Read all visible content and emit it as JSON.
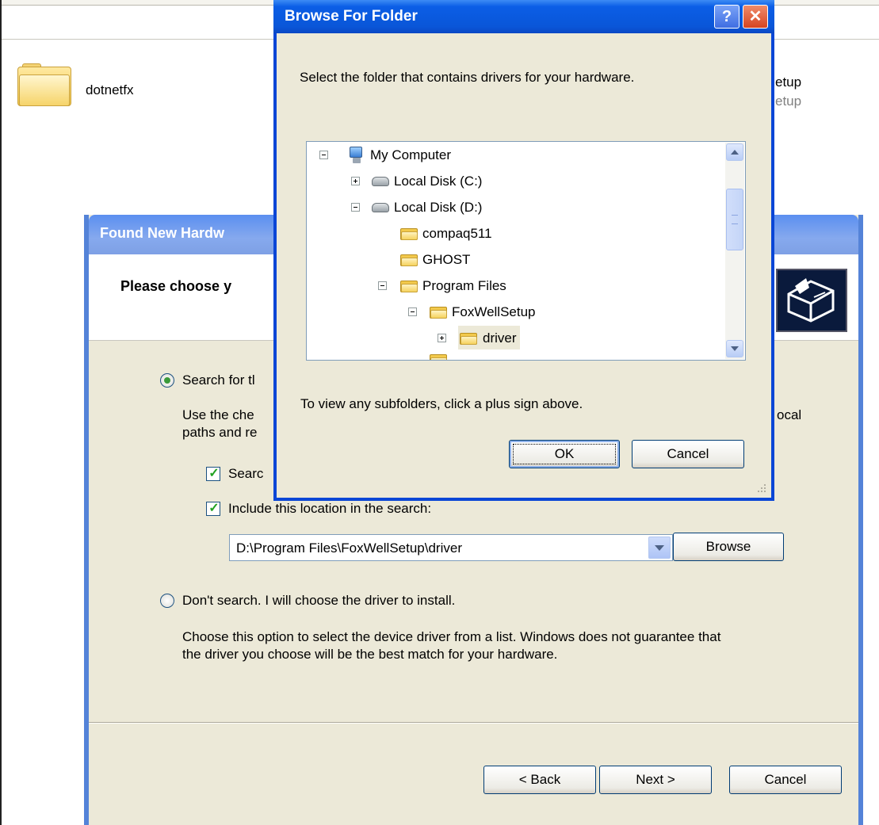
{
  "explorer": {
    "items": [
      {
        "label": "dotnetfx",
        "icon": "folder-icon"
      },
      {
        "label_line1": "etup",
        "label_line2": "etup"
      }
    ]
  },
  "wizard": {
    "title": "Found New Hardw",
    "header_title": "Please choose y",
    "option_search_label": "Search for tl",
    "option_search_desc_line1": "Use the che",
    "option_search_desc_tail": "ocal",
    "option_search_desc_line2": "paths and re",
    "check_removable_label": "Searc",
    "check_removable_checked": true,
    "check_include_label": "Include this location in the search:",
    "check_include_checked": true,
    "location_value": "D:\\Program Files\\FoxWellSetup\\driver",
    "browse_label": "Browse",
    "option_dont_search_label": "Don't search. I will choose the driver to install.",
    "option_dont_search_desc_line1": "Choose this option to select the device driver from a list.  Windows does not guarantee that",
    "option_dont_search_desc_line2": "the driver you choose will be the best match for your hardware.",
    "selected_option": "search",
    "back_label": "< Back",
    "next_label": "Next >",
    "cancel_label": "Cancel"
  },
  "dialog": {
    "title": "Browse For Folder",
    "help_glyph": "?",
    "close_glyph": "✕",
    "instruction": "Select the folder that contains drivers for your hardware.",
    "tree": [
      {
        "label": "My Computer",
        "icon": "computer-icon",
        "expander": "minus"
      },
      {
        "label": "Local Disk (C:)",
        "icon": "disk-icon",
        "expander": "plus"
      },
      {
        "label": "Local Disk (D:)",
        "icon": "disk-icon",
        "expander": "minus"
      },
      {
        "label": "compaq511",
        "icon": "folder-icon",
        "expander": "none"
      },
      {
        "label": "GHOST",
        "icon": "folder-icon",
        "expander": "none"
      },
      {
        "label": "Program Files",
        "icon": "folder-icon",
        "expander": "minus"
      },
      {
        "label": "FoxWellSetup",
        "icon": "folder-icon",
        "expander": "minus"
      },
      {
        "label": "driver",
        "icon": "folder-icon",
        "expander": "plus",
        "selected": true
      }
    ],
    "hint": "To view any subfolders, click a plus sign above.",
    "ok_label": "OK",
    "cancel_label": "Cancel"
  },
  "colors": {
    "xp_blue": "#0a56d8",
    "wizard_title_blue": "#7ea0e5",
    "dialog_bg": "#ece9d8",
    "check_green": "#21a121"
  }
}
